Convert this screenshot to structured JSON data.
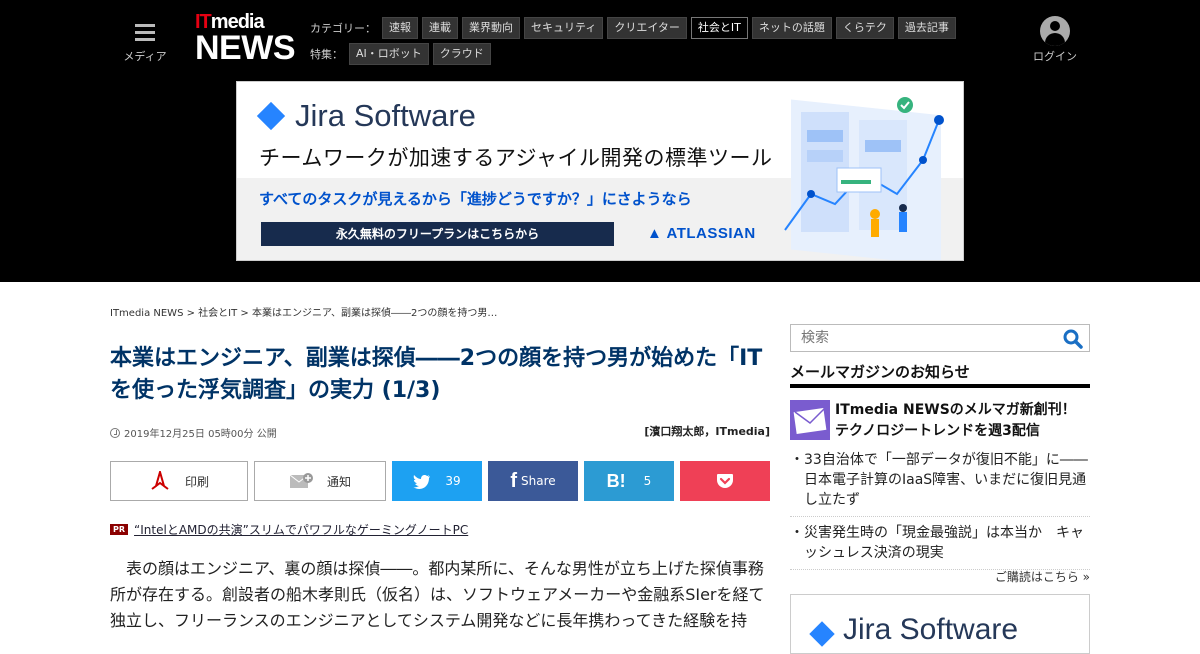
{
  "header": {
    "menu_label": "メディア",
    "logo_it": "IT",
    "logo_media": "media",
    "logo_news": "NEWS",
    "category_caption": "カテゴリー：",
    "categories": [
      "速報",
      "連載",
      "業界動向",
      "セキュリティ",
      "クリエイター",
      "社会とIT",
      "ネットの話題",
      "くらテク",
      "過去記事"
    ],
    "active_category": "社会とIT",
    "feature_caption": "特集：",
    "features": [
      "AI・ロボット",
      "クラウド"
    ],
    "login_label": "ログイン"
  },
  "ad_banner": {
    "brand": "Jira Software",
    "headline": "チームワークが加速するアジャイル開発の標準ツール",
    "subline": "すべてのタスクが見えるから「進捗どうですか？」にさようなら",
    "cta": "永久無料のフリープランはこちらから",
    "sponsor": "ATLASSIAN"
  },
  "breadcrumb": {
    "items": [
      "ITmedia NEWS",
      "社会とIT",
      "本業はエンジニア、副業は探偵――2つの顔を持つ男…"
    ],
    "separator": " > "
  },
  "article": {
    "title": "本業はエンジニア、副業は探偵――2つの顔を持つ男が始めた「ITを使った浮気調査」の実力 (1/3)",
    "date": "2019年12月25日 05時00分 公開",
    "author": "[濱口翔太郎，ITmedia]",
    "pr_badge": "PR",
    "pr_link": "“IntelとAMDの共演”スリムでパワフルなゲーミングノートPC",
    "body": "　表の顔はエンジニア、裏の顔は探偵――。都内某所に、そんな男性が立ち上げた探偵事務所が存在する。創設者の船木孝則氏（仮名）は、ソフトウェアメーカーや金融系SIerを経て独立し、フリーランスのエンジニアとしてシステム開発などに長年携わってきた経験を持"
  },
  "share": {
    "print": "印刷",
    "notify": "通知",
    "twitter_count": "39",
    "facebook": "Share",
    "hatena_count": "5"
  },
  "sidebar": {
    "search_placeholder": "検索",
    "mailmag_heading": "メールマガジンのお知らせ",
    "mailmag_feature": "ITmedia NEWSのメルマガ新創刊！ テクノロジートレンドを週3配信",
    "mailmag_items": [
      "33自治体で「一部データが復旧不能」に――日本電子計算のIaaS障害、いまだに復旧見通し立たず",
      "災害発生時の「現金最強説」は本当か　キャッシュレス決済の現実"
    ],
    "more_link": "ご購読はこちら »",
    "ad2_brand": "Jira Software"
  },
  "colors": {
    "header_bg": "#000000",
    "title": "#003366",
    "twitter": "#1da1f2",
    "facebook": "#3b5998",
    "hatena": "#2c9bd3",
    "pocket": "#ef4056",
    "jira_blue": "#2684ff"
  }
}
